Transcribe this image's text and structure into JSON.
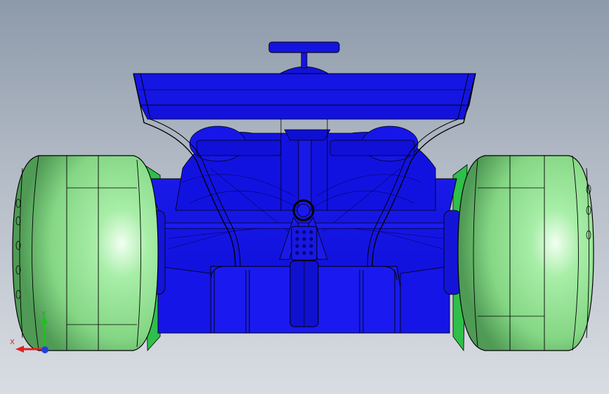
{
  "viewport": {
    "background_top": "#8d9aaa",
    "background_bottom": "#d9dde3"
  },
  "model": {
    "body_color": "#1414e6",
    "body_dark": "#0505a8",
    "tire_color": "#8ee08e",
    "tire_dark": "#3f9a47",
    "edge_color": "#000000"
  },
  "triad": {
    "x_label": "X",
    "y_label": "Y",
    "x_color": "#e02020",
    "y_color": "#20c020",
    "z_color": "#2040e0"
  }
}
